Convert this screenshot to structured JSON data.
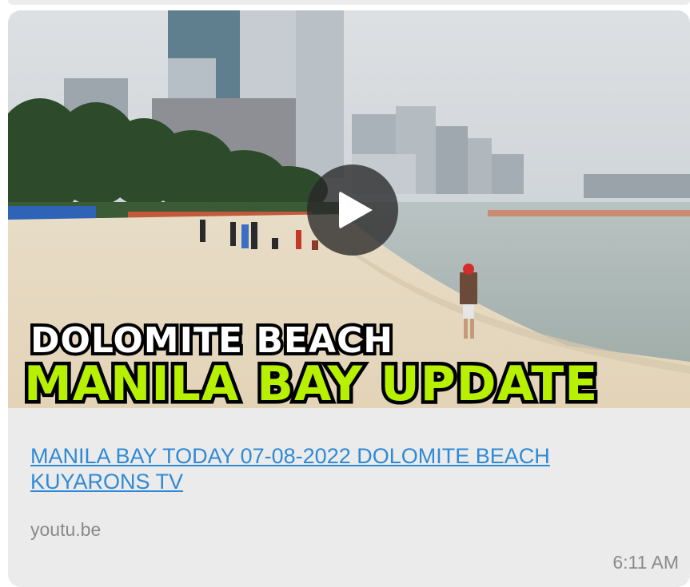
{
  "message": {
    "thumbnail": {
      "overlay_line1": "DOLOMITE BEACH",
      "overlay_line2": "MANILA BAY UPDATE",
      "line1_color": "#ffffff",
      "line2_color": "#b7f000",
      "play_icon": "play-icon"
    },
    "link_title": "MANILA BAY TODAY 07-08-2022 DOLOMITE BEACH KUYARONS TV",
    "link_domain": "youtu.be",
    "timestamp": "6:11 AM",
    "link_color": "#2f8ad6"
  }
}
